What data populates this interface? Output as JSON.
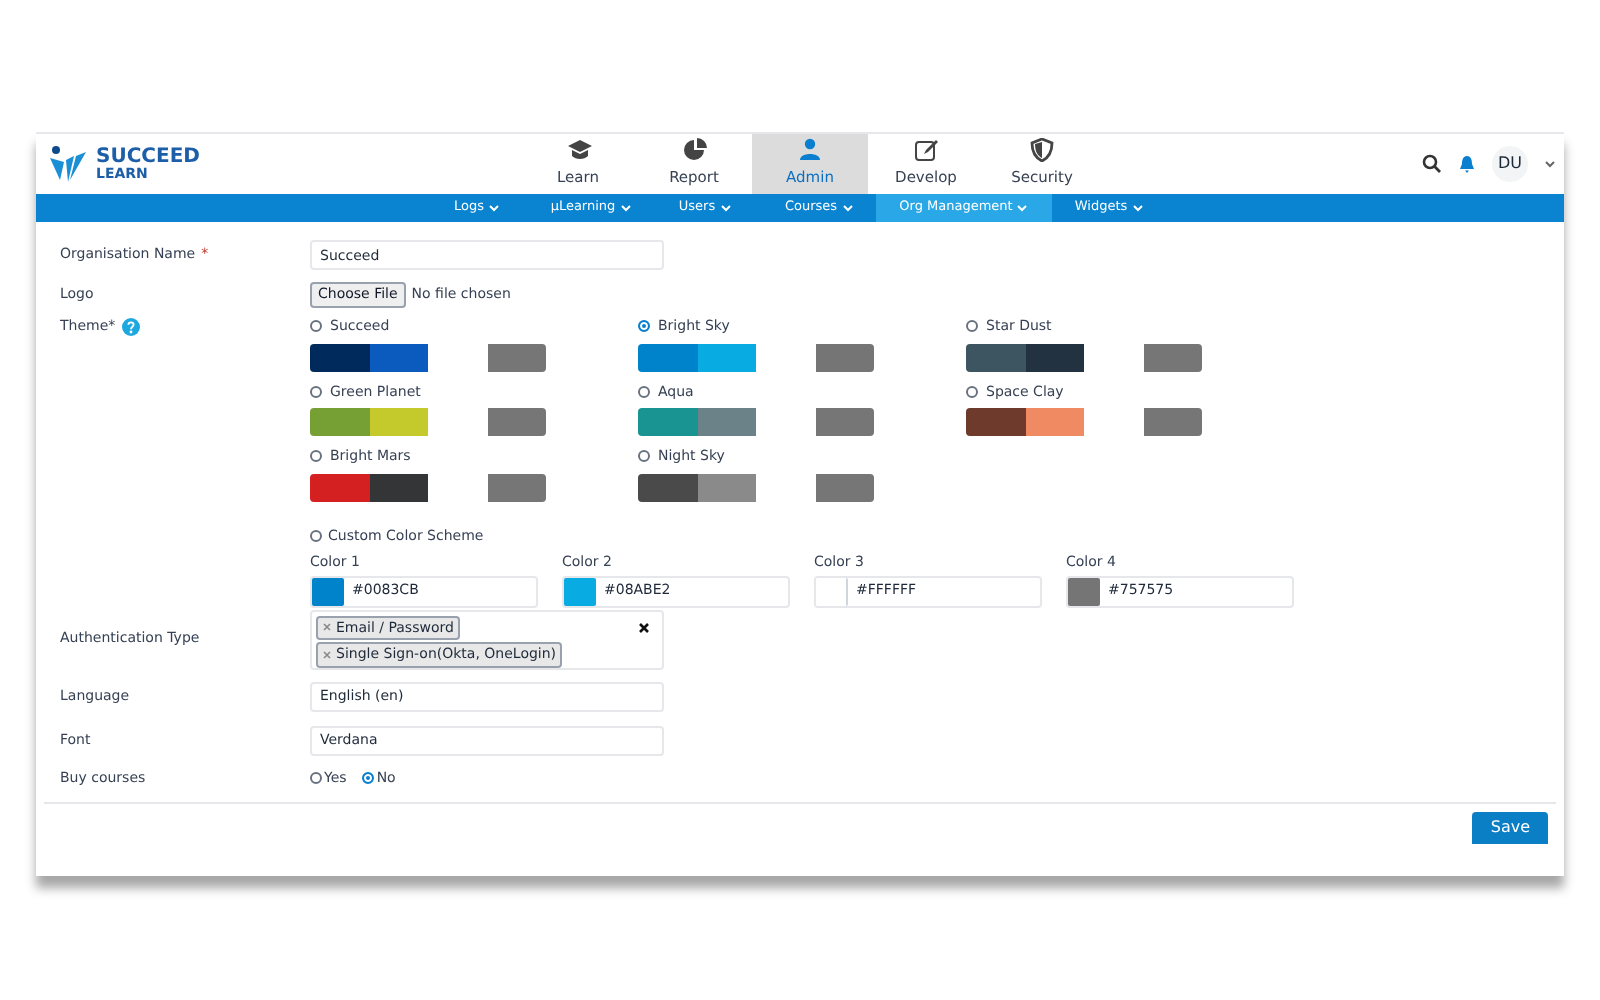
{
  "logo": {
    "title": "SUCCEED",
    "subtitle": "LEARN"
  },
  "nav_tabs": [
    {
      "label": "Learn",
      "kind": "learn",
      "selected": false
    },
    {
      "label": "Report",
      "kind": "report",
      "selected": false
    },
    {
      "label": "Admin",
      "kind": "admin",
      "selected": true
    },
    {
      "label": "Develop",
      "kind": "develop",
      "selected": false
    },
    {
      "label": "Security",
      "kind": "security",
      "selected": false
    }
  ],
  "user": {
    "initials": "DU"
  },
  "sub_nav": [
    {
      "label": "Logs",
      "selected": false
    },
    {
      "label": "µLearning",
      "selected": false
    },
    {
      "label": "Users",
      "selected": false
    },
    {
      "label": "Courses",
      "selected": false
    },
    {
      "label": "Org Management",
      "selected": true
    },
    {
      "label": "Widgets",
      "selected": false
    }
  ],
  "form": {
    "organisation_name": {
      "label": "Organisation Name",
      "required_mark": "*",
      "value": "Succeed"
    },
    "logo": {
      "label": "Logo",
      "button": "Choose File",
      "status": "No file chosen"
    },
    "theme": {
      "label": "Theme*",
      "options": [
        {
          "name": "Succeed",
          "selected": false,
          "palette": [
            {
              "color": "#012a5c"
            },
            {
              "color": "#0a5bbd"
            },
            {
              "color": "#ffffff"
            },
            {
              "color": "#767676"
            }
          ]
        },
        {
          "name": "Bright Sky",
          "selected": true,
          "palette": [
            {
              "color": "#0083cb"
            },
            {
              "color": "#08abe2"
            },
            {
              "color": "#ffffff"
            },
            {
              "color": "#757575"
            }
          ]
        },
        {
          "name": "Star Dust",
          "selected": false,
          "palette": [
            {
              "color": "#3d5560"
            },
            {
              "color": "#223240"
            },
            {
              "color": "#ffffff"
            },
            {
              "color": "#767676"
            }
          ]
        },
        {
          "name": "Green Planet",
          "selected": false,
          "palette": [
            {
              "color": "#76a033"
            },
            {
              "color": "#c4c92c"
            },
            {
              "color": "#ffffff"
            },
            {
              "color": "#767676"
            }
          ]
        },
        {
          "name": "Aqua",
          "selected": false,
          "palette": [
            {
              "color": "#1a9393"
            },
            {
              "color": "#6a8288"
            },
            {
              "color": "#ffffff"
            },
            {
              "color": "#767676"
            }
          ]
        },
        {
          "name": "Space Clay",
          "selected": false,
          "palette": [
            {
              "color": "#6e3a2c"
            },
            {
              "color": "#f08a62"
            },
            {
              "color": "#ffffff"
            },
            {
              "color": "#767676"
            }
          ]
        },
        {
          "name": "Bright Mars",
          "selected": false,
          "palette": [
            {
              "color": "#d42020"
            },
            {
              "color": "#343536"
            },
            {
              "color": "#ffffff"
            },
            {
              "color": "#767676"
            }
          ]
        },
        {
          "name": "Night Sky",
          "selected": false,
          "palette": [
            {
              "color": "#4a4a4a"
            },
            {
              "color": "#8a8a8a"
            },
            {
              "color": "#ffffff"
            },
            {
              "color": "#767676"
            }
          ]
        }
      ],
      "custom": {
        "label": "Custom Color Scheme",
        "selected": false,
        "colors": [
          {
            "label": "Color 1",
            "color": "#0083cb",
            "value": "#0083CB"
          },
          {
            "label": "Color 2",
            "color": "#08abe2",
            "value": "#08ABE2"
          },
          {
            "label": "Color 3",
            "color": "#ffffff",
            "value": "#FFFFFF"
          },
          {
            "label": "Color 4",
            "color": "#757575",
            "value": "#757575"
          }
        ]
      }
    },
    "authentication_type": {
      "label": "Authentication Type",
      "tags": [
        "Email / Password",
        "Single Sign-on(Okta, OneLogin)"
      ]
    },
    "language": {
      "label": "Language",
      "value": "English (en)"
    },
    "font": {
      "label": "Font",
      "value": "Verdana"
    },
    "buy_courses": {
      "label": "Buy courses",
      "options": [
        {
          "label": "Yes",
          "selected": false
        },
        {
          "label": "No",
          "selected": true
        }
      ]
    }
  },
  "save_button": "Save"
}
